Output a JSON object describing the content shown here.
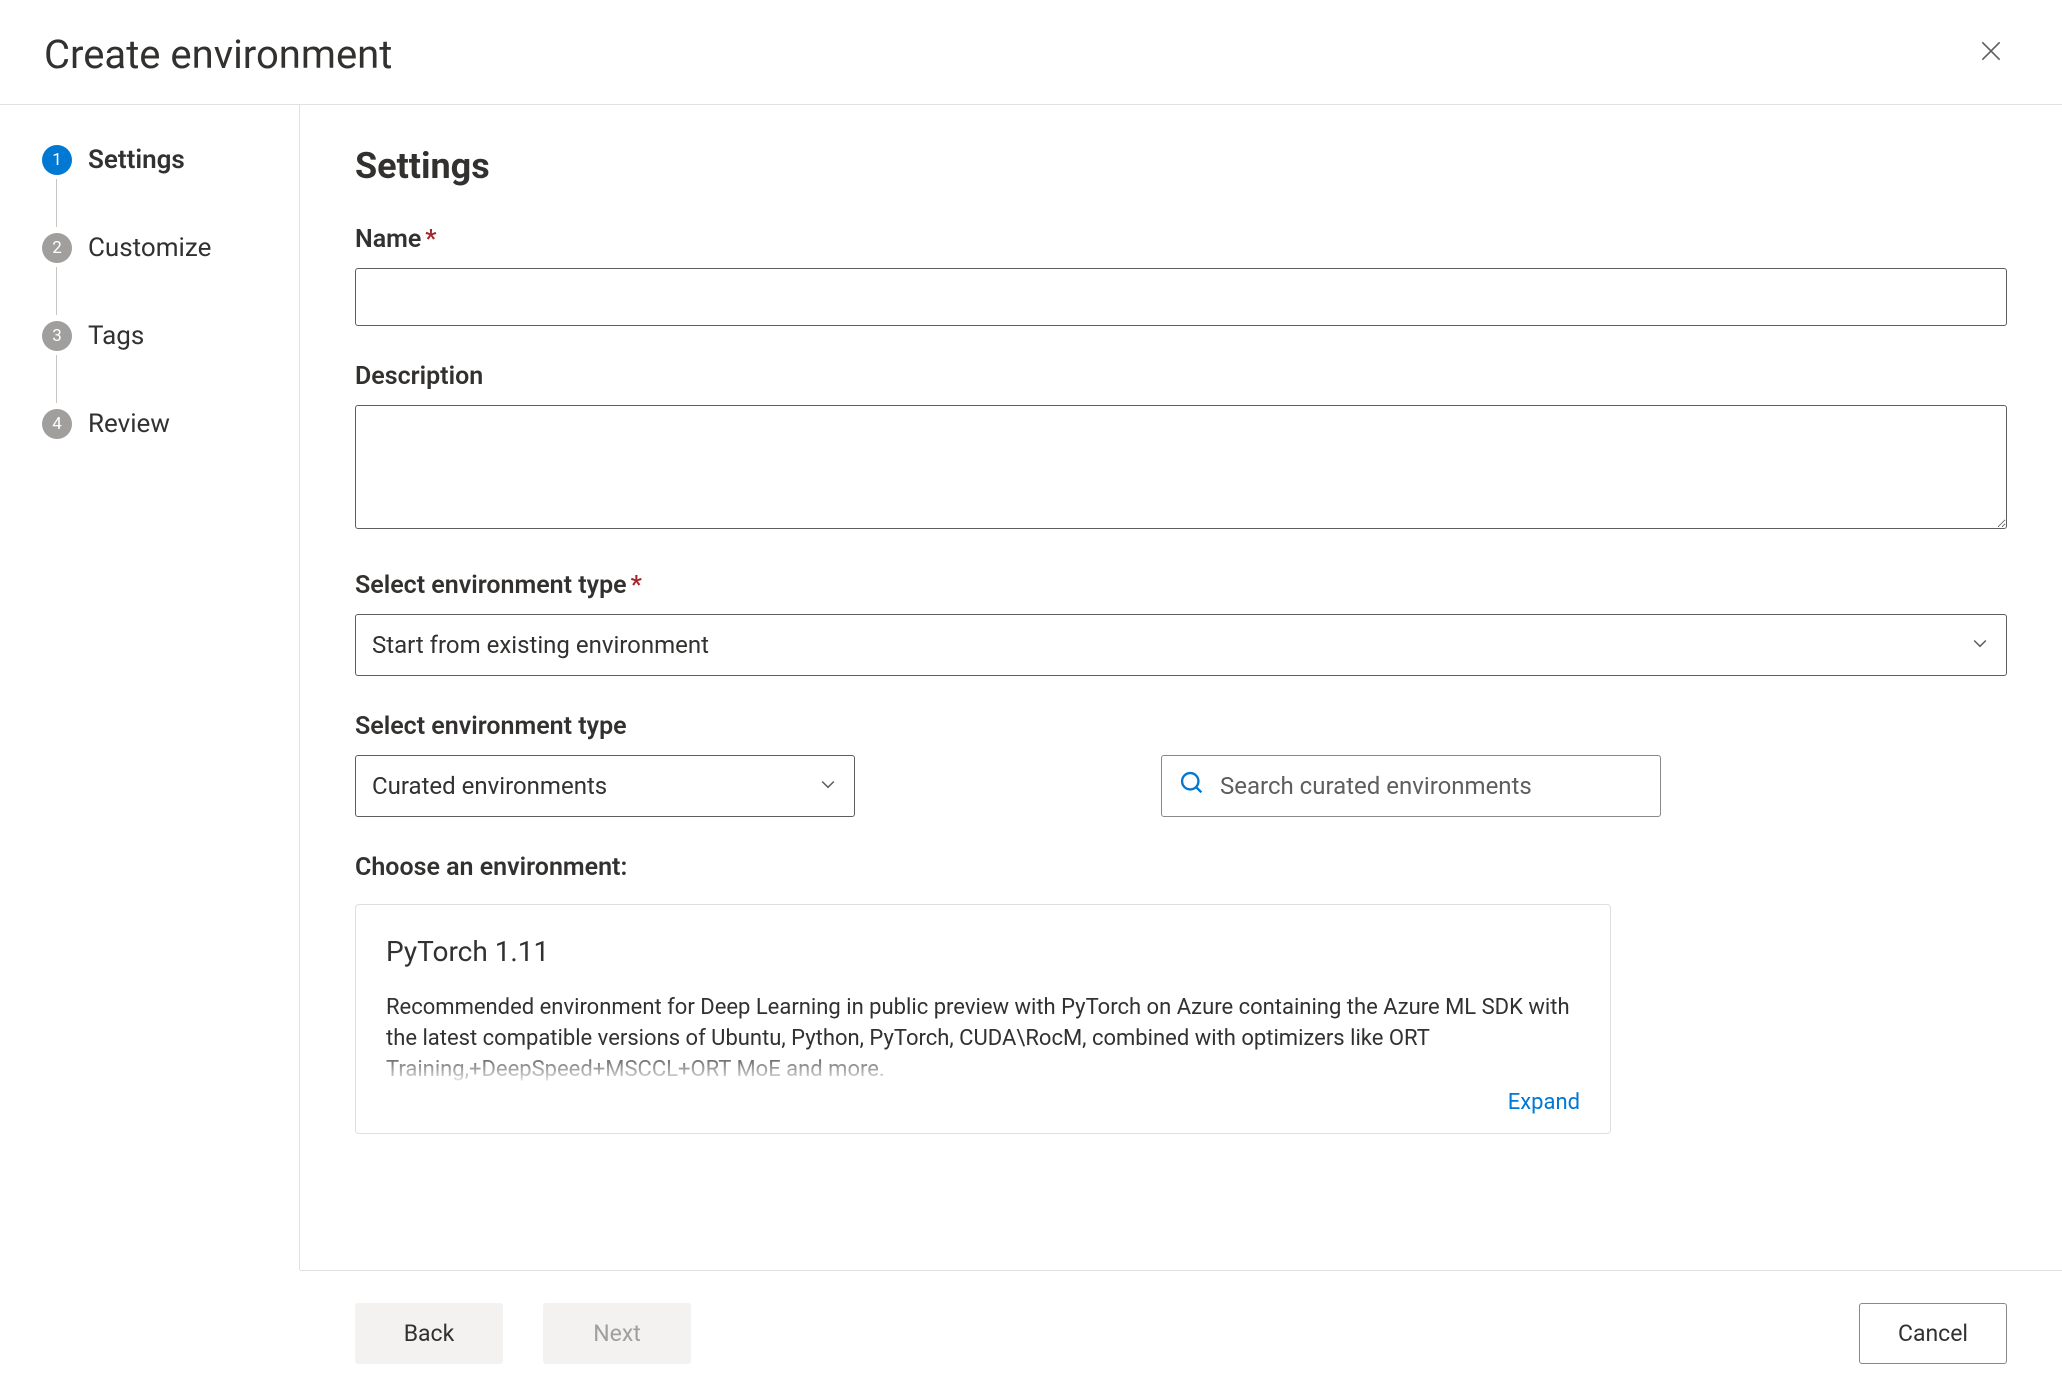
{
  "header": {
    "title": "Create environment"
  },
  "steps": [
    {
      "num": "1",
      "label": "Settings"
    },
    {
      "num": "2",
      "label": "Customize"
    },
    {
      "num": "3",
      "label": "Tags"
    },
    {
      "num": "4",
      "label": "Review"
    }
  ],
  "form": {
    "section_title": "Settings",
    "name_label": "Name",
    "name_value": "",
    "description_label": "Description",
    "description_value": "",
    "env_type_label": "Select environment type",
    "env_type_value": "Start from existing environment",
    "env_subtype_label": "Select environment type",
    "env_subtype_value": "Curated environments",
    "search_placeholder": "Search curated environments",
    "choose_label": "Choose an environment:"
  },
  "card": {
    "title": "PyTorch 1.11",
    "desc": "Recommended environment for Deep Learning in public preview with PyTorch on Azure containing the Azure ML SDK with the latest compatible versions of Ubuntu, Python, PyTorch, CUDA\\RocM, combined with optimizers like ORT Training,+DeepSpeed+MSCCL+ORT MoE and more.",
    "expand": "Expand"
  },
  "footer": {
    "back": "Back",
    "next": "Next",
    "cancel": "Cancel"
  },
  "colors": {
    "primary": "#0078d4",
    "text": "#323130",
    "required": "#a4262c"
  }
}
